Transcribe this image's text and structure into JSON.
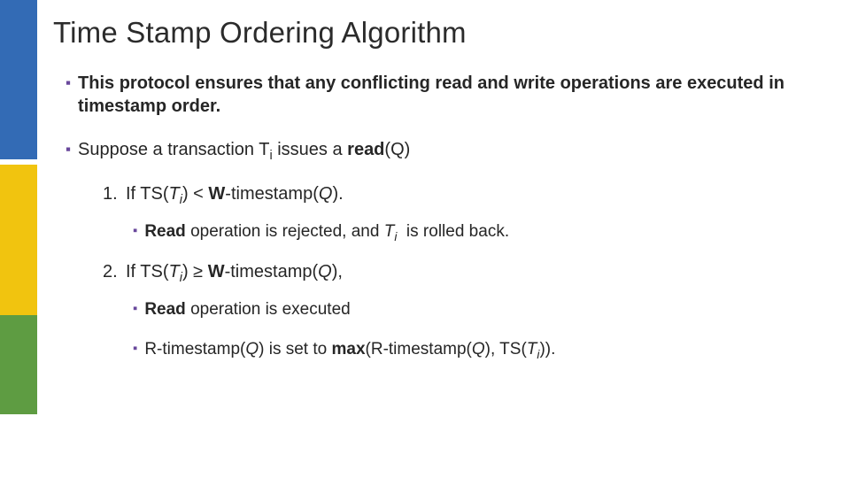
{
  "title": "Time Stamp Ordering Algorithm",
  "bullets": [
    {
      "html": "<b>This protocol ensures that any conflicting read and write operations are executed in timestamp order.</b>"
    },
    {
      "html": "Suppose a transaction T<span class='sub'>i</span> issues a <b>read</b>(Q)",
      "numbered": [
        {
          "num": "1.",
          "html": "If TS(<i>T<span class='sub'>i</span></i>) &lt; <b>W</b>-timestamp(<i>Q</i>).",
          "subs": [
            {
              "html": "<b>Read</b> operation is rejected, and <i>T<span class='sub'>i</span></i>&nbsp; is rolled back."
            }
          ]
        },
        {
          "num": "2.",
          "html": "If TS(<i>T<span class='sub'>i</span></i>) ≥ <b>W</b>-timestamp(<i>Q</i>),",
          "subs": [
            {
              "html": "<b>Read</b> operation is executed"
            },
            {
              "html": "R-timestamp(<i>Q</i>) is set to <b>max</b>(R-timestamp(<i>Q</i>), TS(<i>T<span class='sub'>i</span></i>))."
            }
          ]
        }
      ]
    }
  ],
  "sidebar_colors": {
    "blue": "#336bb5",
    "yellow": "#f1c40f",
    "green": "#5e9c42"
  },
  "bullet_marker_color": "#69489c"
}
